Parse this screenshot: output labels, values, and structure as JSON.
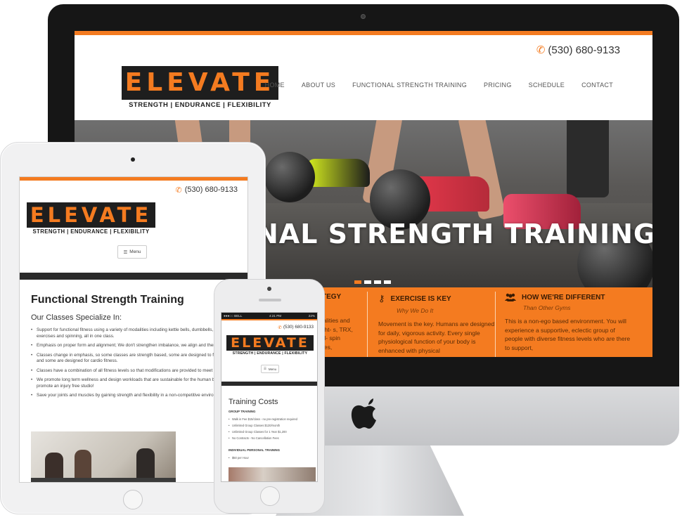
{
  "brand": {
    "name": "ELEVATE",
    "tagline": "STRENGTH | ENDURANCE | FLEXIBILITY",
    "phone": "(530) 680-9133",
    "accent": "#f47b20",
    "dark": "#1e1e1e"
  },
  "desktop": {
    "nav": [
      "HOME",
      "ABOUT US",
      "FUNCTIONAL STRENGTH TRAINING",
      "PRICING",
      "SCHEDULE",
      "CONTACT"
    ],
    "hero_title": "NAL STRENGTH TRAINING",
    "features": [
      {
        "icon": "chart-icon",
        "title": "TEGY",
        "subtitle": "",
        "body": "odalities and Light- s, TRX, pull- spin bikes,"
      },
      {
        "icon": "key-icon",
        "title": "EXERCISE IS KEY",
        "subtitle": "Why We Do It",
        "body": "Movement is the key. Humans are designed for daily, vigorous activity. Every single physiological function of your body is enhanced with physical"
      },
      {
        "icon": "group-icon",
        "title": "HOW WE'RE DIFFERENT",
        "subtitle": "Than Other Gyms",
        "body": "This is a non-ego based environment. You will experience a supportive, eclectic group of people with diverse fitness levels who are there to support,"
      }
    ]
  },
  "tablet": {
    "menu_label": "Menu",
    "heading": "Functional Strength Training",
    "subheading": "Our Classes Specialize In:",
    "bullets": [
      "Support for functional fitness using a variety of modalities including kettle bells, dumbbells, TRX, body weight exercises and spinning, all in one class.",
      "Emphasis on proper form and alignment; We don't strengthen imbalance, we align and then strengthen.",
      "Classes change in emphasis, so some classes are strength based, some are designed to focus on postural health and some are designed for cardio fitness.",
      "Classes have a combination of all fitness levels so that modifications are provided to meet everyone's needs.",
      "We promote long term wellness and design workloads that are sustainable for the human body.  We proudly promote an injury free studio!",
      "Save your joints and muscles by gaining strength and flexibility in a non-competitive environment."
    ]
  },
  "phone_device": {
    "status": {
      "carrier": "●●●○○ BELL",
      "time": "4:21 PM",
      "battery": "22%"
    },
    "menu_label": "Menu",
    "heading": "Training Costs",
    "group_title": "GROUP TRAINING",
    "group_items": [
      "Walk in Fee $15/class - no pre-registration required",
      "Unlimited Group Classes $120/month",
      "Unlimited Group Classes for 1 Year $1,200",
      "No Contracts - No Cancellation Fees"
    ],
    "personal_title": "INDIVIDUAL PERSONAL TRAINING",
    "personal_items": [
      "$50 per Hour"
    ]
  }
}
